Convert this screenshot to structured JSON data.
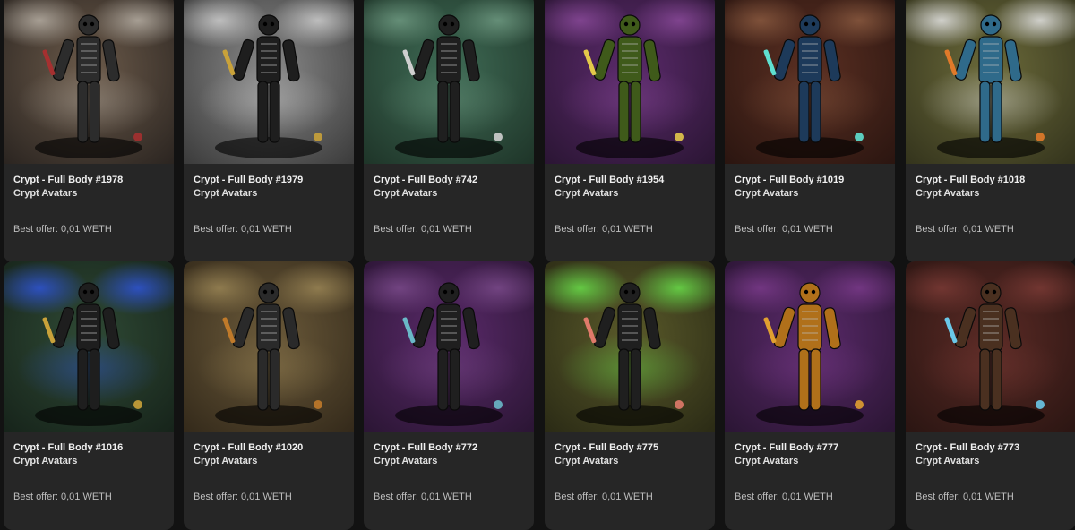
{
  "items": [
    {
      "title": "Crypt - Full Body #1978",
      "collection": "Crypt Avatars",
      "offer": "Best offer: 0,01 WETH",
      "bg": "#6b5a4a",
      "bg2": "#2a2420",
      "smoke": "#b8b0a5",
      "body": "#2c2c2c",
      "accent": "#a53030"
    },
    {
      "title": "Crypt - Full Body #1979",
      "collection": "Crypt Avatars",
      "offer": "Best offer: 0,01 WETH",
      "bg": "#8a8a8a",
      "bg2": "#3a3a3a",
      "smoke": "#cfcfcf",
      "body": "#1e1e1e",
      "accent": "#c9a23a"
    },
    {
      "title": "Crypt - Full Body #742",
      "collection": "Crypt Avatars",
      "offer": "Best offer: 0,01 WETH",
      "bg": "#3f6b55",
      "bg2": "#1e3428",
      "smoke": "#6f9a82",
      "body": "#1f1f1f",
      "accent": "#cfcfcf"
    },
    {
      "title": "Crypt - Full Body #1954",
      "collection": "Crypt Avatars",
      "offer": "Best offer: 0,01 WETH",
      "bg": "#5a2a6a",
      "bg2": "#2a1533",
      "smoke": "#8a4a9a",
      "body": "#3f5a1a",
      "accent": "#e3c94a"
    },
    {
      "title": "Crypt - Full Body #1019",
      "collection": "Crypt Avatars",
      "offer": "Best offer: 0,01 WETH",
      "bg": "#5a2f22",
      "bg2": "#2a1510",
      "smoke": "#8a5a40",
      "body": "#1d3a5a",
      "accent": "#5fe0d0"
    },
    {
      "title": "Crypt - Full Body #1018",
      "collection": "Crypt Avatars",
      "offer": "Best offer: 0,01 WETH",
      "bg": "#6b6a3a",
      "bg2": "#33331c",
      "smoke": "#e8e8e8",
      "body": "#2f6a8a",
      "accent": "#e07a2a"
    },
    {
      "title": "Crypt - Full Body #1016",
      "collection": "Crypt Avatars",
      "offer": "Best offer: 0,01 WETH",
      "bg": "#2f4a35",
      "bg2": "#16231a",
      "smoke": "#2f55d8",
      "body": "#1e1e1e",
      "accent": "#c9a23a"
    },
    {
      "title": "Crypt - Full Body #1020",
      "collection": "Crypt Avatars",
      "offer": "Best offer: 0,01 WETH",
      "bg": "#6b5a3a",
      "bg2": "#33291a",
      "smoke": "#9a8555",
      "body": "#2a2a2a",
      "accent": "#c07a2a"
    },
    {
      "title": "Crypt - Full Body #772",
      "collection": "Crypt Avatars",
      "offer": "Best offer: 0,01 WETH",
      "bg": "#5a2a6a",
      "bg2": "#2a1533",
      "smoke": "#7a4a8a",
      "body": "#1f1f1f",
      "accent": "#6ab8c8"
    },
    {
      "title": "Crypt - Full Body #775",
      "collection": "Crypt Avatars",
      "offer": "Best offer: 0,01 WETH",
      "bg": "#5a5a2a",
      "bg2": "#2a2a15",
      "smoke": "#6ae04a",
      "body": "#1f1f1f",
      "accent": "#e07a6a"
    },
    {
      "title": "Crypt - Full Body #777",
      "collection": "Crypt Avatars",
      "offer": "Best offer: 0,01 WETH",
      "bg": "#5a2a6a",
      "bg2": "#2a1533",
      "smoke": "#7a3a8a",
      "body": "#b0701a",
      "accent": "#e0a030"
    },
    {
      "title": "Crypt - Full Body #773",
      "collection": "Crypt Avatars",
      "offer": "Best offer: 0,01 WETH",
      "bg": "#5a2a25",
      "bg2": "#2a1512",
      "smoke": "#7a3a35",
      "body": "#4a3020",
      "accent": "#6ac8e8"
    }
  ]
}
